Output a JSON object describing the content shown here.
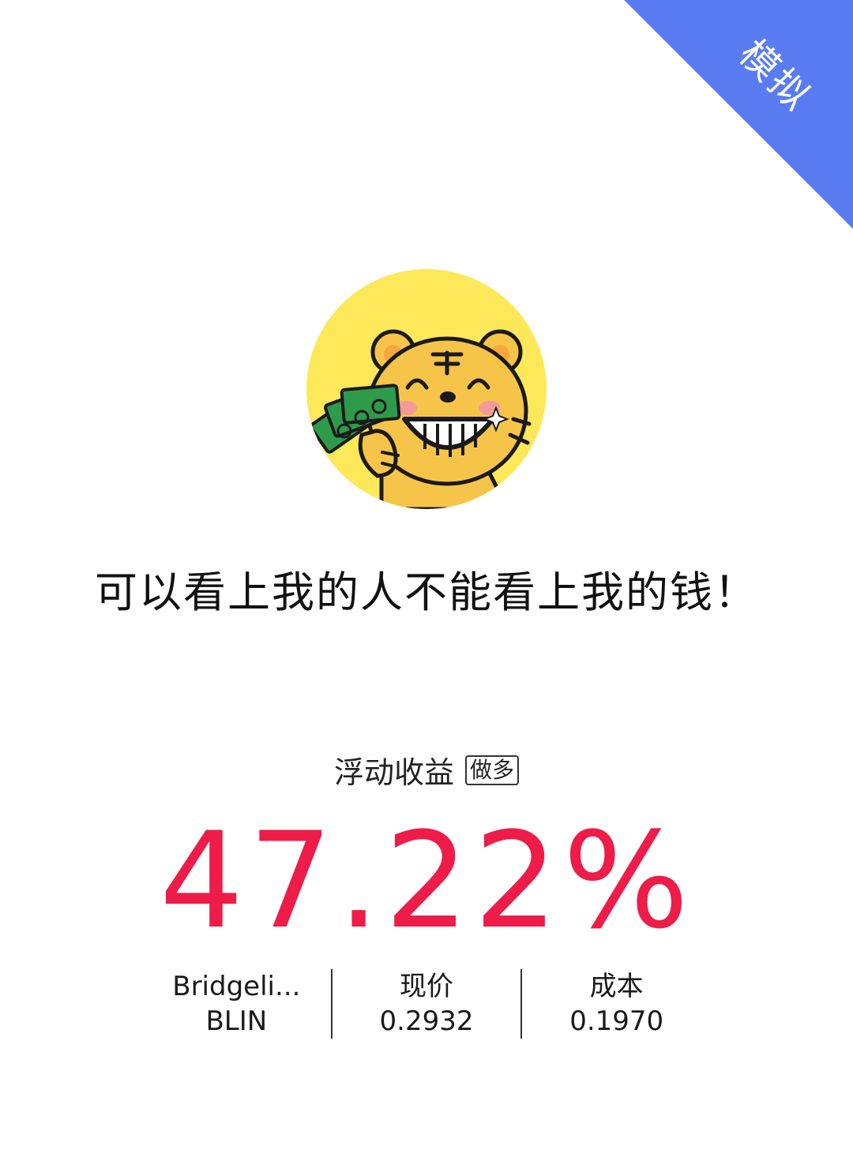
{
  "ribbon": {
    "label": "模拟",
    "color": "#5a7cf2"
  },
  "avatar": {
    "icon": "tiger-holding-money-icon",
    "background": "#fde85a"
  },
  "slogan": "可以看上我的人不能看上我的钱！",
  "section": {
    "title": "浮动收益",
    "badge": "做多"
  },
  "pnl": {
    "value": "47.22%",
    "color": "#ee1c48"
  },
  "stats": [
    {
      "top": "Bridgeli...",
      "bottom": "BLIN"
    },
    {
      "top": "现价",
      "bottom": "0.2932"
    },
    {
      "top": "成本",
      "bottom": "0.1970"
    }
  ]
}
